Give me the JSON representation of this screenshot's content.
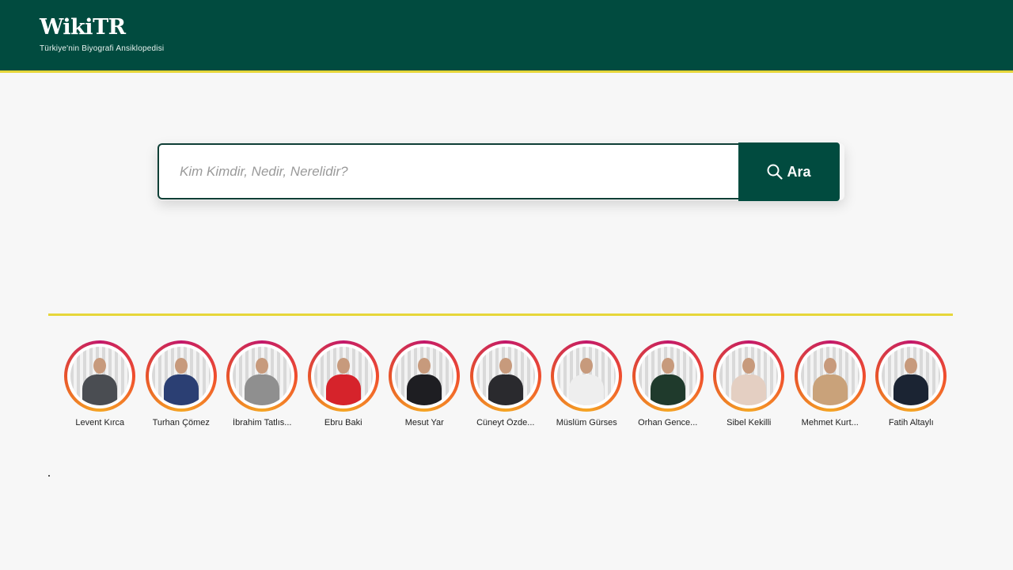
{
  "header": {
    "logo": "WikiTR",
    "tagline": "Türkiye'nin Biyografi Ansiklopedisi"
  },
  "search": {
    "placeholder": "Kim Kimdir, Nedir, Nerelidir?",
    "value": "",
    "button_label": "Ara"
  },
  "people": [
    {
      "name": "Levent Kırca",
      "color": "#4a4d52"
    },
    {
      "name": "Turhan Çömez",
      "color": "#2b3f73"
    },
    {
      "name": "İbrahim Tatlıs...",
      "color": "#8f8f8f"
    },
    {
      "name": "Ebru Baki",
      "color": "#d6232b"
    },
    {
      "name": "Mesut Yar",
      "color": "#1e1e22"
    },
    {
      "name": "Cüneyt Özde...",
      "color": "#2a2a2e"
    },
    {
      "name": "Müslüm Gürses",
      "color": "#eeeeee"
    },
    {
      "name": "Orhan Gence...",
      "color": "#1f3a2c"
    },
    {
      "name": "Sibel Kekilli",
      "color": "#e4cfc2"
    },
    {
      "name": "Mehmet Kurt...",
      "color": "#c9a27a"
    },
    {
      "name": "Fatih Altaylı",
      "color": "#1b2433"
    }
  ]
}
